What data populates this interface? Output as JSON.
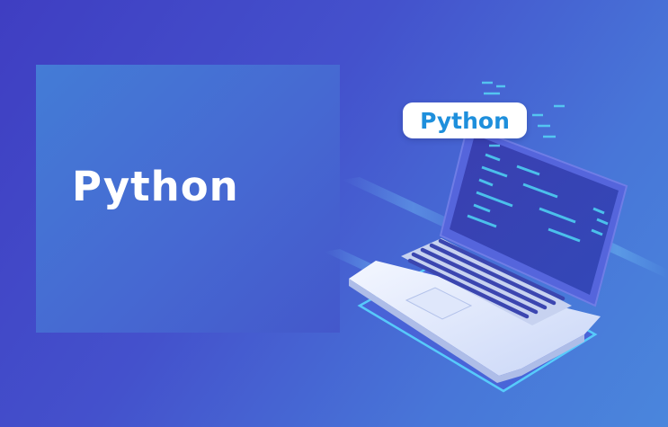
{
  "panel": {
    "title": "Python"
  },
  "badge": {
    "label": "Python"
  },
  "colors": {
    "background_start": "#3f3ec2",
    "background_end": "#4a86dc",
    "badge_text": "#1e8fdc",
    "code_cyan": "#4fd6f5",
    "laptop_body": "#e3ecff"
  },
  "icons": {
    "illustration": "laptop-icon"
  }
}
